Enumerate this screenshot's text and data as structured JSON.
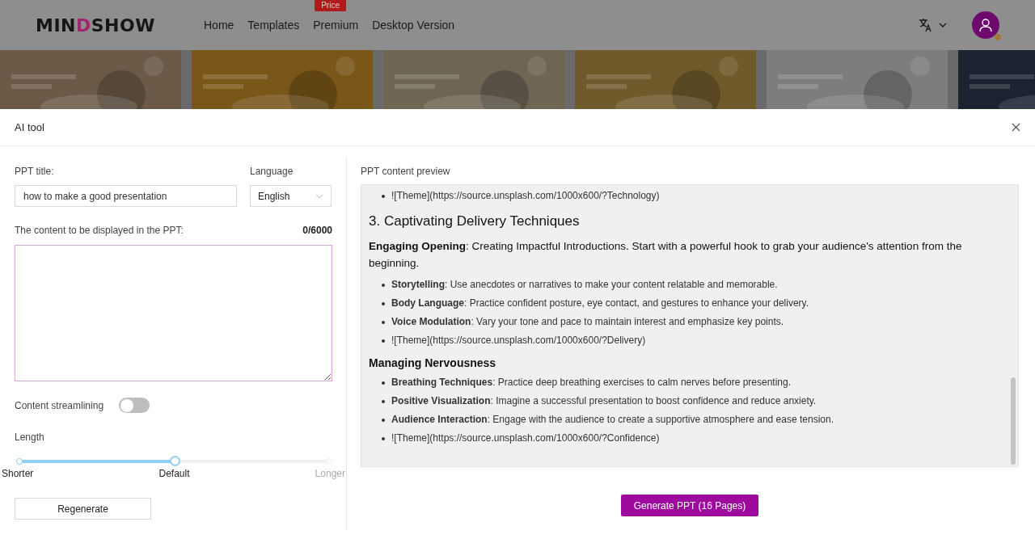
{
  "header": {
    "logo": {
      "before": "MIN",
      "mark": "D",
      "after": "SHOW"
    },
    "nav": [
      {
        "label": "Home"
      },
      {
        "label": "Templates"
      },
      {
        "label": "Premium",
        "badge": "Price"
      },
      {
        "label": "Desktop Version"
      }
    ]
  },
  "modal": {
    "title": "AI tool",
    "form": {
      "title_label": "PPT title:",
      "title_value": "how to make a good presentation",
      "language_label": "Language",
      "language_value": "English",
      "content_label": "The content to be displayed in the PPT:",
      "content_count": "0/6000",
      "streamlining": {
        "label": "Content streamlining",
        "on": false
      },
      "length": {
        "label": "Length",
        "level": 0.5,
        "marks": [
          {
            "label": "Shorter"
          },
          {
            "label": "Default"
          },
          {
            "label": "Longer"
          }
        ]
      },
      "regenerate": "Regenerate"
    },
    "preview": {
      "label": "PPT content preview",
      "items": [
        {
          "kind": "bullet",
          "text": "![Theme](https://source.unsplash.com/1000x600/?Technology)"
        },
        {
          "kind": "heading",
          "text": "3. Captivating Delivery Techniques"
        },
        {
          "kind": "paragraph",
          "text": "**Engaging Opening**: Creating Impactful Introductions. Start with a powerful hook to grab your audience's attention from the beginning."
        },
        {
          "kind": "bullet",
          "text": "**Storytelling**: Use anecdotes or narratives to make your content relatable and memorable."
        },
        {
          "kind": "bullet",
          "text": "**Body Language**: Practice confident posture, eye contact, and gestures to enhance your delivery."
        },
        {
          "kind": "bullet",
          "text": "**Voice Modulation**: Vary your tone and pace to maintain interest and emphasize key points."
        },
        {
          "kind": "bullet",
          "text": "![Theme](https://source.unsplash.com/1000x600/?Delivery)"
        },
        {
          "kind": "subheading",
          "text": "**Managing Nervousness**"
        },
        {
          "kind": "bullet",
          "text": "**Breathing Techniques**: Practice deep breathing exercises to calm nerves before presenting."
        },
        {
          "kind": "bullet",
          "text": "**Positive Visualization**: Imagine a successful presentation to boost confidence and reduce anxiety."
        },
        {
          "kind": "bullet",
          "text": "**Audience Interaction**: Engage with the audience to create a supportive atmosphere and ease tension."
        },
        {
          "kind": "bullet",
          "text": "![Theme](https://source.unsplash.com/1000x600/?Confidence)"
        }
      ]
    },
    "generate": "Generate PPT (16 Pages)"
  }
}
